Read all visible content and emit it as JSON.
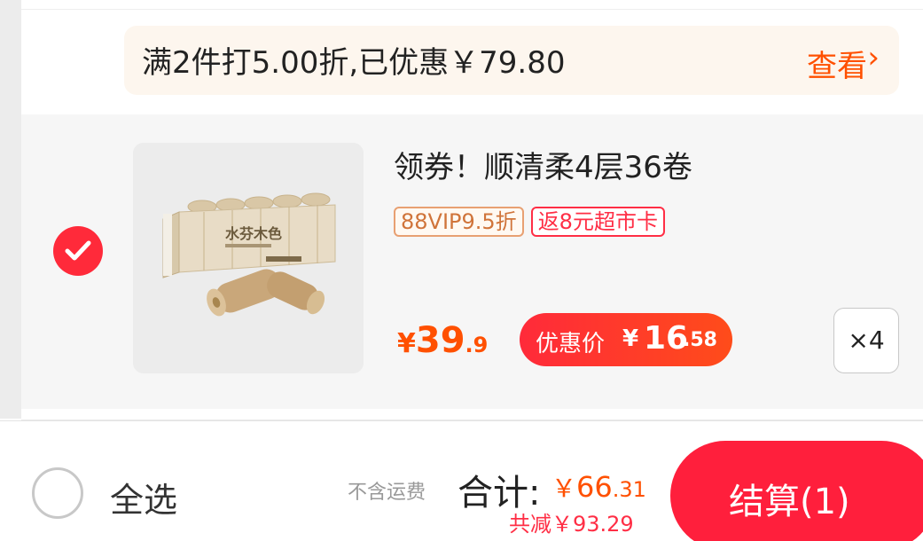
{
  "promo": {
    "text": "满2件打5.00折,已优惠￥79.80",
    "view_label": "查看",
    "view_icon": "chevron-right-icon"
  },
  "item": {
    "selected": true,
    "title": "领券！顺清柔4层36卷",
    "tags": [
      "88VIP9.5折",
      "返8元超市卡"
    ],
    "price": {
      "currency": "¥",
      "integer": "39",
      "decimal": ".9"
    },
    "deal": {
      "label": "优惠价",
      "currency": "¥",
      "integer": "16",
      "decimal": ".58"
    },
    "quantity": "×4",
    "image_icon": "toilet-paper-pack-image"
  },
  "footer": {
    "select_all_label": "全选",
    "shipping_note": "不含运费",
    "total_label": "合计:",
    "total": {
      "currency": "￥",
      "integer": "66",
      "decimal": ".31"
    },
    "saved_text": "共减￥93.29",
    "checkout_label": "结算(1)"
  },
  "colors": {
    "accent_orange": "#ff5000",
    "accent_red": "#ff1f3c",
    "promo_bg": "#fdf6ee",
    "card_bg": "#f6f6f6"
  }
}
